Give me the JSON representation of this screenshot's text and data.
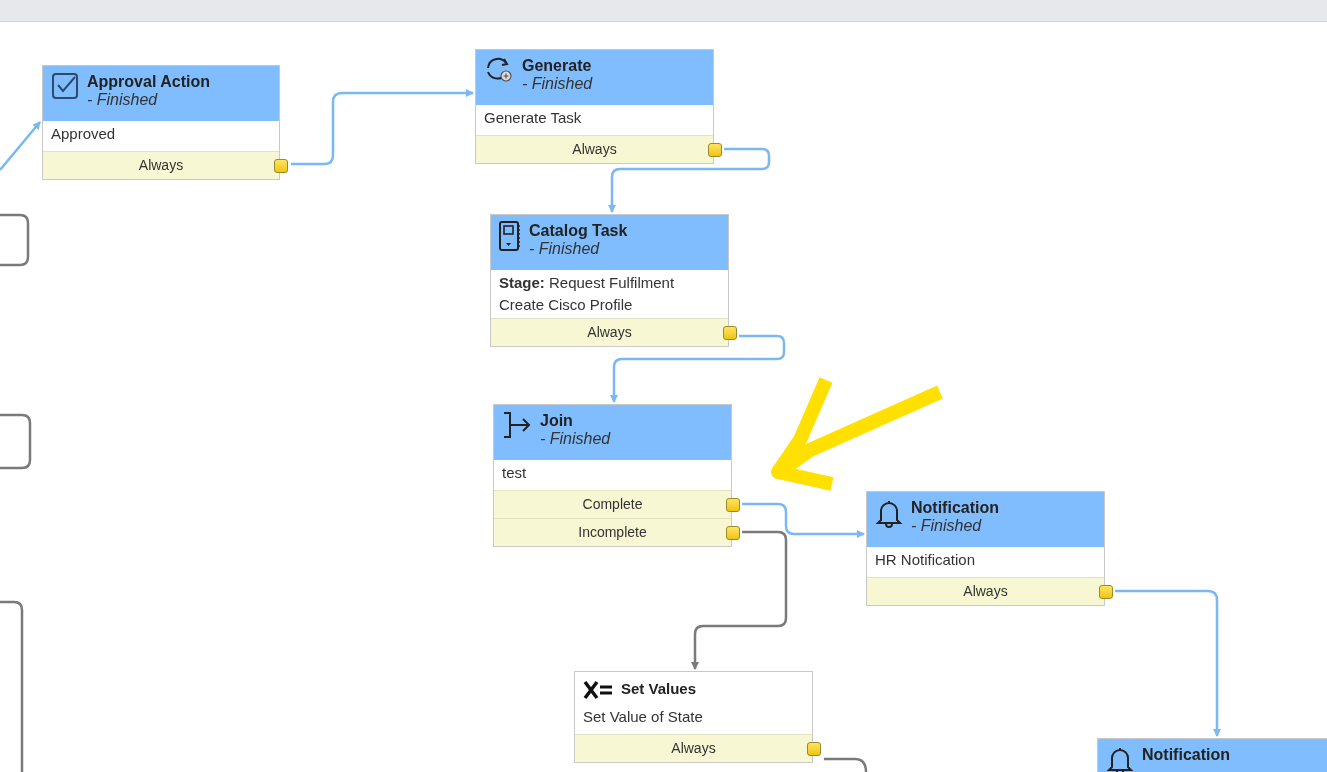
{
  "nodes": [
    {
      "kind": "approval",
      "title": "Approval Action",
      "status": "- Finished",
      "finished": true,
      "body": [
        "Approved"
      ],
      "conditions": [
        {
          "label": "Always"
        }
      ]
    },
    {
      "kind": "generate",
      "title": "Generate",
      "status": "- Finished",
      "finished": true,
      "body": [
        "Generate Task"
      ],
      "conditions": [
        {
          "label": "Always"
        }
      ]
    },
    {
      "kind": "catalog_task",
      "title": "Catalog Task",
      "status": "- Finished",
      "finished": true,
      "body": [
        "**Stage:** Request Fulfilment",
        "Create Cisco Profile"
      ],
      "conditions": [
        {
          "label": "Always"
        }
      ]
    },
    {
      "kind": "join",
      "title": "Join",
      "status": "- Finished",
      "finished": true,
      "body": [
        "test"
      ],
      "conditions": [
        {
          "label": "Complete"
        },
        {
          "label": "Incomplete"
        }
      ]
    },
    {
      "kind": "notification",
      "title": "Notification",
      "status": "- Finished",
      "finished": true,
      "body": [
        "HR Notification"
      ],
      "conditions": [
        {
          "label": "Always"
        }
      ]
    },
    {
      "kind": "set_values",
      "title": "Set Values",
      "finished": false,
      "body": [
        "Set Value of State"
      ],
      "conditions": [
        {
          "label": "Always"
        }
      ]
    },
    {
      "kind": "notification",
      "title": "Notification",
      "finished": true
    }
  ]
}
